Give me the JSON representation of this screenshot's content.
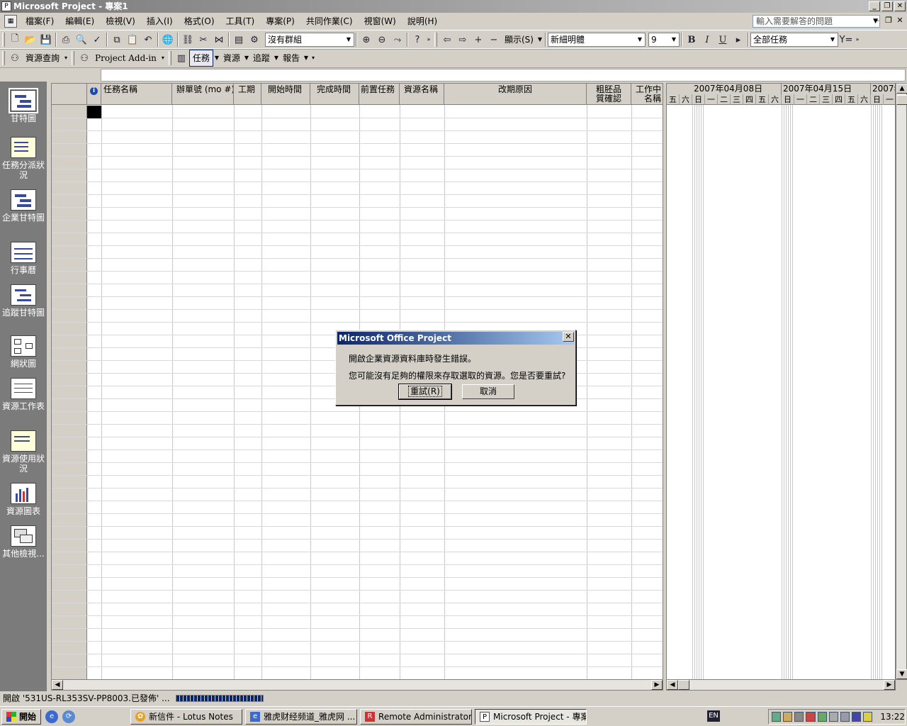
{
  "window": {
    "title": "Microsoft Project - 專案1"
  },
  "menu": [
    "檔案(F)",
    "編輯(E)",
    "檢視(V)",
    "插入(I)",
    "格式(O)",
    "工具(T)",
    "專案(P)",
    "共同作業(C)",
    "視窗(W)",
    "說明(H)"
  ],
  "help_box": {
    "placeholder": "輸入需要解答的問題"
  },
  "toolbar1": {
    "group_combo": "沒有群組",
    "show_label": "顯示(S)",
    "font_combo": "新細明體",
    "size_combo": "9",
    "bold": "B",
    "italic": "I",
    "underline": "U",
    "filter_combo": "全部任務"
  },
  "toolbar2": {
    "resource_query": "資源查詢",
    "project_addin": "Project Add-in",
    "task": "任務",
    "resource": "資源",
    "track": "追蹤",
    "report": "報告"
  },
  "viewbar": [
    {
      "label": "甘特圖",
      "icon": "gantt-chart-icon"
    },
    {
      "label": "任務分派狀況",
      "icon": "task-usage-icon"
    },
    {
      "label": "企業甘特圖",
      "icon": "enterprise-gantt-icon"
    },
    {
      "label": "行事曆",
      "icon": "calendar-icon"
    },
    {
      "label": "追蹤甘特圖",
      "icon": "tracking-gantt-icon"
    },
    {
      "label": "網狀圖",
      "icon": "network-diagram-icon"
    },
    {
      "label": "資源工作表",
      "icon": "resource-sheet-icon"
    },
    {
      "label": "資源使用狀況",
      "icon": "resource-usage-icon"
    },
    {
      "label": "資源圖表",
      "icon": "resource-graph-icon"
    },
    {
      "label": "其他檢視...",
      "icon": "more-views-icon"
    }
  ],
  "table": {
    "info_icon": "i",
    "columns": [
      "任務名稱",
      "辦單號 (mo #)",
      "工期",
      "開始時間",
      "完成時間",
      "前置任務",
      "資源名稱",
      "改期原因",
      "粗胚品質確認",
      "工作中名稱"
    ]
  },
  "gantt": {
    "weeks": [
      "2007年04月08日",
      "2007年04月15日",
      "2007年"
    ],
    "days": [
      "五",
      "六",
      "日",
      "一",
      "二",
      "三",
      "四",
      "五",
      "六",
      "日",
      "一",
      "二",
      "三",
      "四",
      "五",
      "六",
      "日",
      "一"
    ]
  },
  "status": {
    "text": "開啟 '531US-RL353SV-PP8003.已發佈' ..."
  },
  "dialog": {
    "title": "Microsoft Office Project",
    "line1": "開啟企業資源資料庫時發生錯誤。",
    "line2": "您可能沒有足夠的權限來存取選取的資源。您是否要重試?",
    "retry": "重試(R)",
    "cancel": "取消"
  },
  "taskbar": {
    "start": "開始",
    "tasks": [
      "新信件 - Lotus Notes",
      "雅虎财经频道_雅虎网 ...",
      "Remote Administrator - ...",
      "Microsoft Project - 專案1"
    ],
    "lang": "EN",
    "clock": "13:22"
  }
}
